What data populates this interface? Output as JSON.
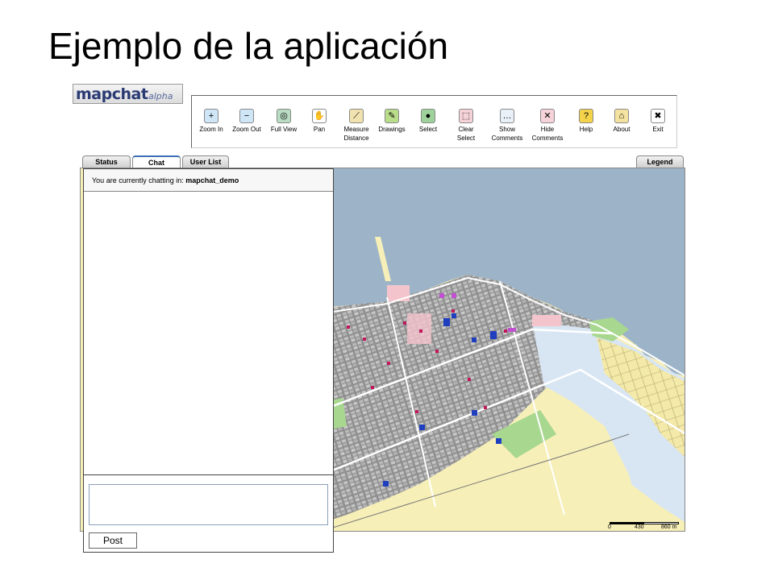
{
  "slide": {
    "title": "Ejemplo de la aplicación"
  },
  "logo": {
    "main": "mapchat",
    "sub": "alpha"
  },
  "toolbar": {
    "tools": [
      {
        "label1": "Zoom In",
        "label2": "",
        "icon": "zoom-in-icon",
        "glyph": "+",
        "color": "#cfe6f7"
      },
      {
        "label1": "Zoom Out",
        "label2": "",
        "icon": "zoom-out-icon",
        "glyph": "−",
        "color": "#cfe6f7"
      },
      {
        "label1": "Full View",
        "label2": "",
        "icon": "full-view-icon",
        "glyph": "◎",
        "color": "#b9dcc2"
      },
      {
        "label1": "Pan",
        "label2": "",
        "icon": "hand-icon",
        "glyph": "✋",
        "color": "#ffffff"
      },
      {
        "label1": "Measure",
        "label2": "Distance",
        "icon": "ruler-icon",
        "glyph": "⟋",
        "color": "#f1e3b0"
      },
      {
        "label1": "Drawings",
        "label2": "",
        "icon": "pencil-icon",
        "glyph": "✎",
        "color": "#b9dc8a"
      },
      {
        "label1": "Select",
        "label2": "",
        "icon": "globe-icon",
        "glyph": "●",
        "color": "#9fd29a"
      },
      {
        "label1": "Clear",
        "label2": "Select",
        "icon": "clear-select-icon",
        "glyph": "⬚",
        "color": "#f6d3d8"
      },
      {
        "label1": "Show",
        "label2": "Comments",
        "icon": "speech-bubble-icon",
        "glyph": "…",
        "color": "#e8f0f8"
      },
      {
        "label1": "Hide",
        "label2": "Comments",
        "icon": "hide-comments-icon",
        "glyph": "✕",
        "color": "#f6d3d8"
      },
      {
        "label1": "Help",
        "label2": "",
        "icon": "help-icon",
        "glyph": "?",
        "color": "#f4d34a"
      },
      {
        "label1": "About",
        "label2": "",
        "icon": "house-icon",
        "glyph": "⌂",
        "color": "#f4e2a0"
      },
      {
        "label1": "Exit",
        "label2": "",
        "icon": "exit-icon",
        "glyph": "✖",
        "color": "#ffffff"
      }
    ]
  },
  "tabs": {
    "status": "Status",
    "chat": "Chat",
    "user_list": "User List",
    "legend": "Legend"
  },
  "chat": {
    "header_prefix": "You are currently chatting in: ",
    "room": "mapchat_demo",
    "post_label": "Post"
  },
  "map": {
    "scale_labels": [
      "0",
      "430",
      "860 m"
    ]
  },
  "colors": {
    "water": "#9db4c8",
    "residential": "#f6eeb0",
    "commercial": "#f4c4cc",
    "park": "#a8d890",
    "institutional": "#d8e6f4",
    "roads": "#ffffff"
  }
}
